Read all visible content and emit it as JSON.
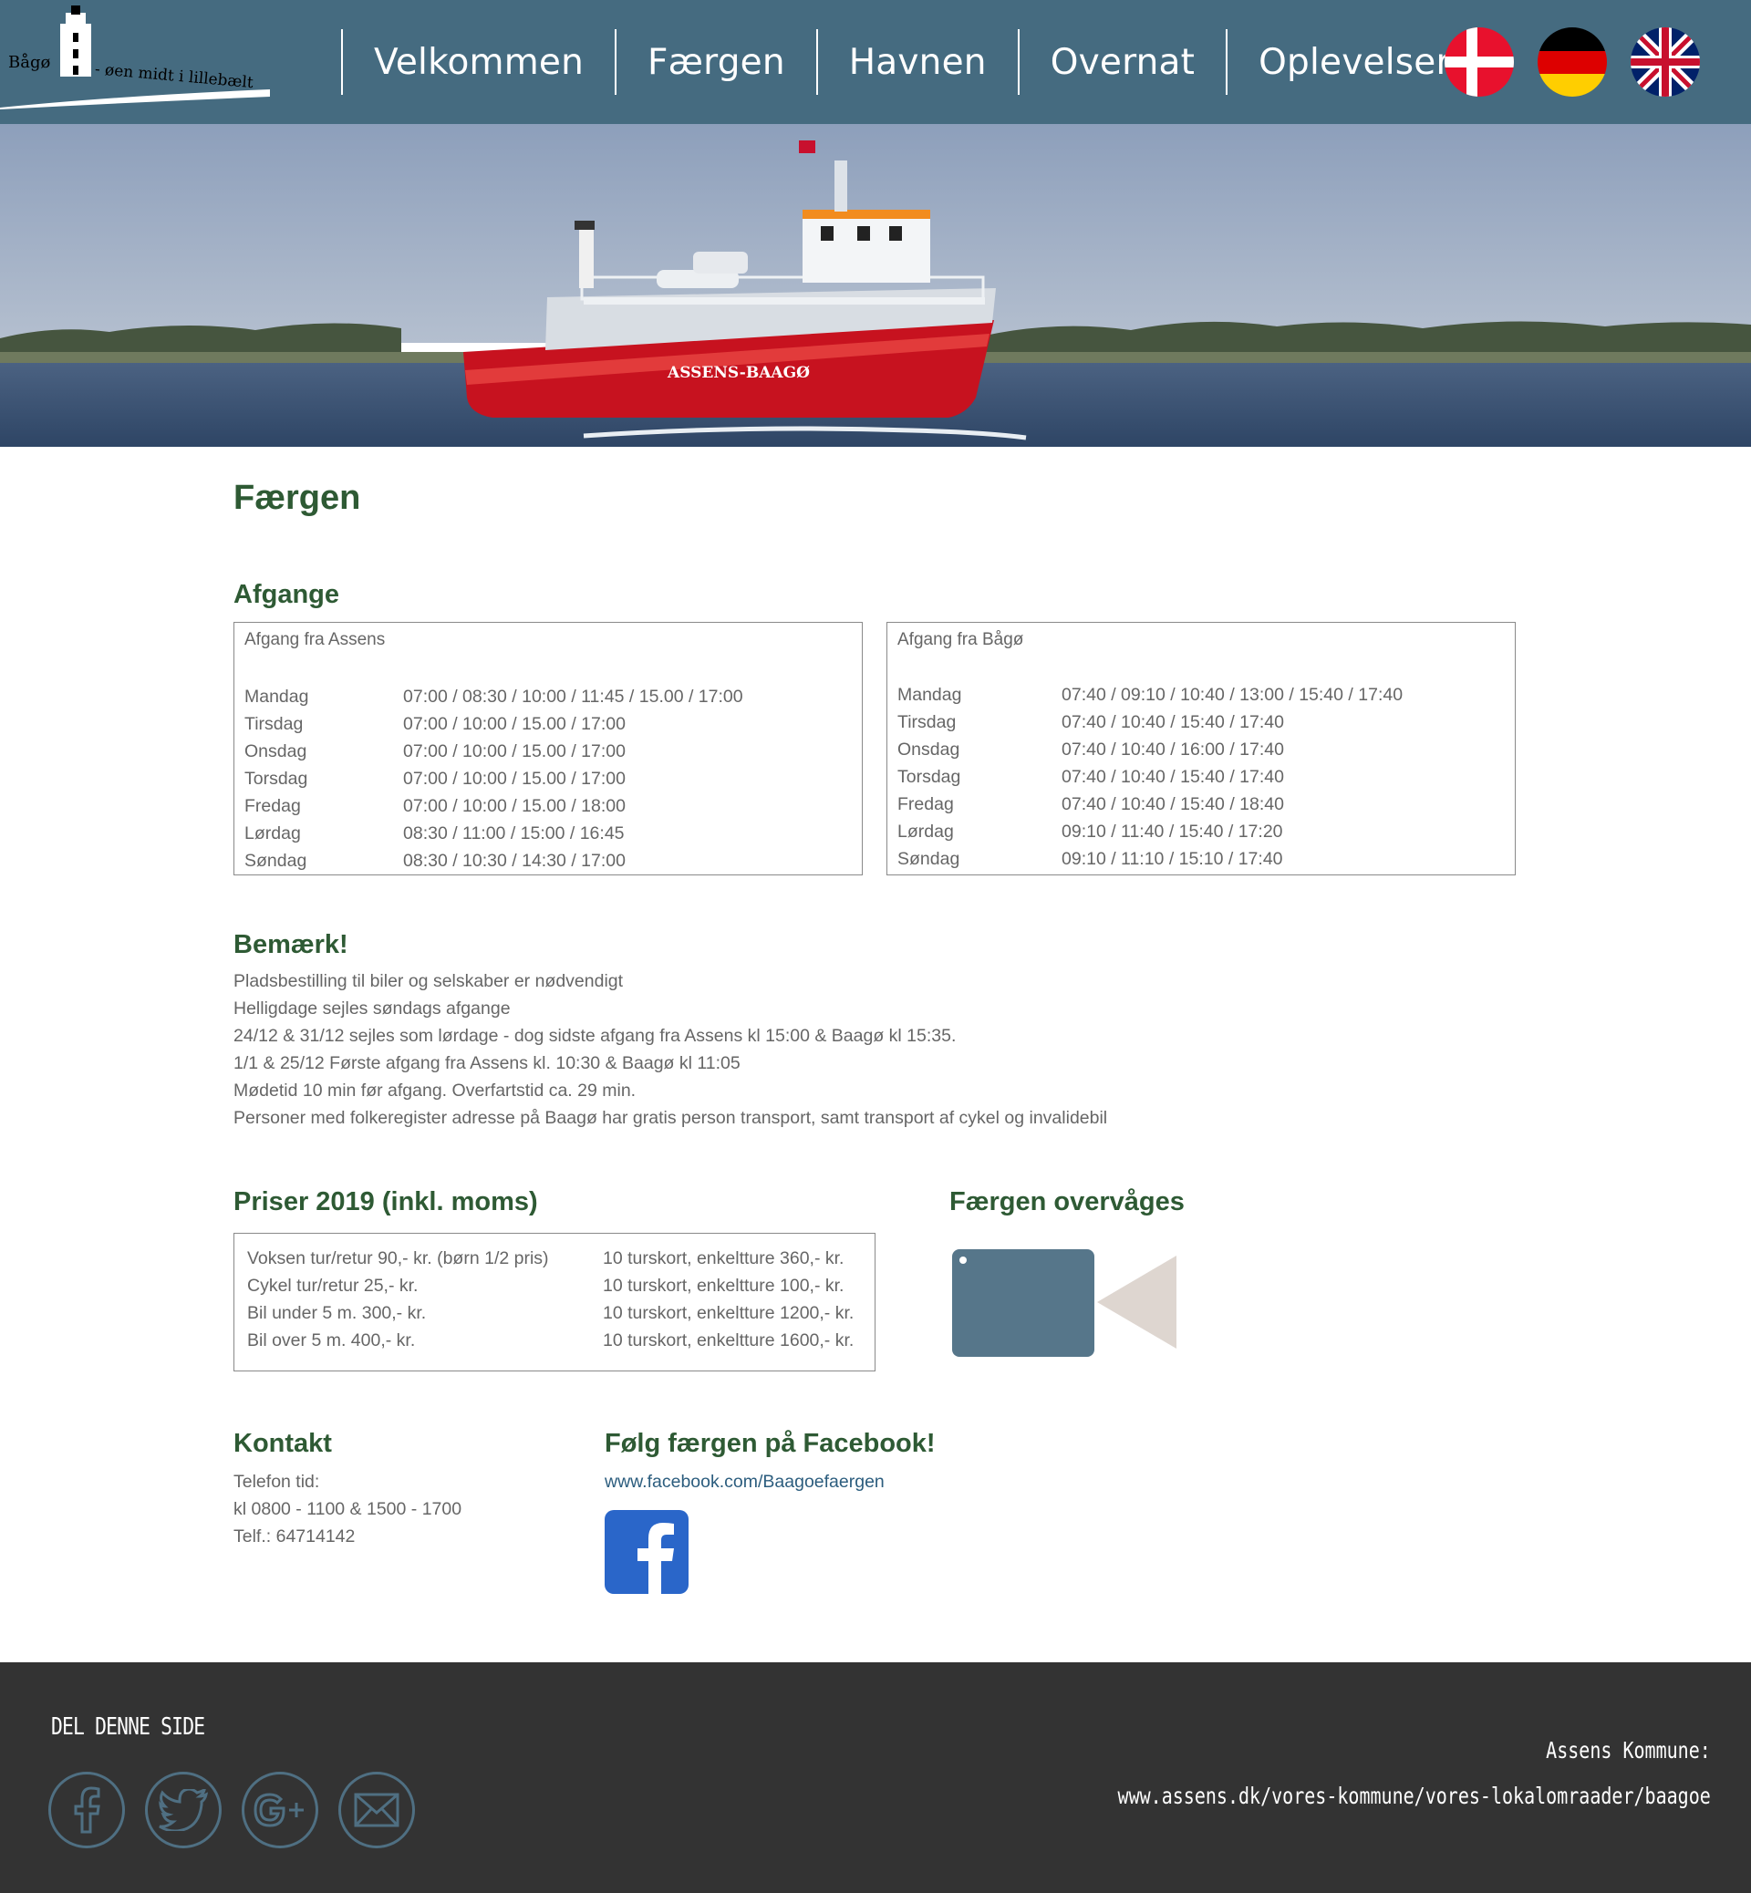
{
  "logo": {
    "left_text": "Bågø",
    "tagline": "- øen midt i lillebælt"
  },
  "nav": {
    "items": [
      "Velkommen",
      "Færgen",
      "Havnen",
      "Overnat",
      "Oplevelser"
    ]
  },
  "flags": [
    {
      "icon": "danish-flag-icon"
    },
    {
      "icon": "german-flag-icon"
    },
    {
      "icon": "uk-flag-icon"
    }
  ],
  "hero": {
    "ship_name": "ASSENS-BAAGØ"
  },
  "page_title": "Færgen",
  "departures": {
    "heading": "Afgange",
    "assens": {
      "title": "Afgang fra Assens",
      "rows": [
        {
          "day": "Mandag",
          "times": "07:00 / 08:30 / 10:00 / 11:45 / 15.00 / 17:00"
        },
        {
          "day": "Tirsdag",
          "times": "07:00 / 10:00 / 15.00 / 17:00"
        },
        {
          "day": "Onsdag",
          "times": "07:00 / 10:00 / 15.00 / 17:00"
        },
        {
          "day": "Torsdag",
          "times": "07:00 / 10:00 / 15.00 / 17:00"
        },
        {
          "day": "Fredag",
          "times": "07:00 / 10:00 / 15.00 / 18:00"
        },
        {
          "day": "Lørdag",
          "times": "08:30 / 11:00 / 15:00 / 16:45"
        },
        {
          "day": "Søndag",
          "times": "08:30 / 10:30 / 14:30 / 17:00"
        }
      ]
    },
    "bago": {
      "title": "Afgang fra Bågø",
      "rows": [
        {
          "day": "Mandag",
          "times": "07:40 / 09:10 / 10:40 / 13:00 / 15:40 / 17:40"
        },
        {
          "day": "Tirsdag",
          "times": "07:40 / 10:40 / 15:40 / 17:40"
        },
        {
          "day": "Onsdag",
          "times": "07:40 / 10:40 / 16:00 / 17:40"
        },
        {
          "day": "Torsdag",
          "times": "07:40 / 10:40 / 15:40 / 17:40"
        },
        {
          "day": "Fredag",
          "times": "07:40 / 10:40 / 15:40 / 18:40"
        },
        {
          "day": "Lørdag",
          "times": "09:10 / 11:40 / 15:40 / 17:20"
        },
        {
          "day": "Søndag",
          "times": "09:10 / 11:10 / 15:10 / 17:40"
        }
      ]
    }
  },
  "notes": {
    "heading": "Bemærk!",
    "lines": [
      "Pladsbestilling til biler og selskaber er nødvendigt",
      "Helligdage sejles søndags afgange",
      "24/12 & 31/12 sejles som lørdage - dog sidste afgang fra Assens kl 15:00 & Baagø kl 15:35.",
      "1/1 & 25/12 Første afgang fra Assens kl. 10:30 & Baagø kl 11:05",
      "Mødetid 10 min før afgang. Overfartstid ca. 29 min.",
      "Personer med folkeregister adresse på Baagø har gratis person transport, samt transport af cykel og invalidebil"
    ]
  },
  "prices": {
    "heading": "Priser 2019 (inkl. moms)",
    "left": [
      "Voksen tur/retur 90,- kr. (børn 1/2 pris)",
      "Cykel tur/retur 25,- kr.",
      "Bil under 5 m. 300,- kr.",
      "Bil over 5 m. 400,- kr."
    ],
    "right": [
      "10 turskort, enkeltture 360,- kr.",
      "10 turskort, enkeltture 100,- kr.",
      "10 turskort, enkeltture 1200,- kr.",
      "10 turskort, enkeltture 1600,- kr."
    ]
  },
  "monitor": {
    "heading": "Færgen overvåges",
    "icon": "video-camera-icon"
  },
  "contact": {
    "heading": "Kontakt",
    "lines": [
      "Telefon tid:",
      "kl 0800 - 1100 & 1500 - 1700",
      "Telf.: 64714142"
    ]
  },
  "facebook": {
    "heading": "Følg færgen på Facebook!",
    "link": "www.facebook.com/Baagoefaergen",
    "icon": "facebook-icon"
  },
  "footer": {
    "share_title": "DEL DENNE SIDE",
    "social_icons": [
      "facebook-icon",
      "twitter-icon",
      "google-plus-icon",
      "mail-icon"
    ],
    "kommune_label": "Assens Kommune:",
    "kommune_link": "www.assens.dk/vores-kommune/vores-lokalomraader/baagoe"
  },
  "colors": {
    "header": "#456b80",
    "heading_green": "#2e5a34",
    "footer": "#333333",
    "camera_body": "#56768a",
    "camera_lens": "#ded6d0"
  }
}
